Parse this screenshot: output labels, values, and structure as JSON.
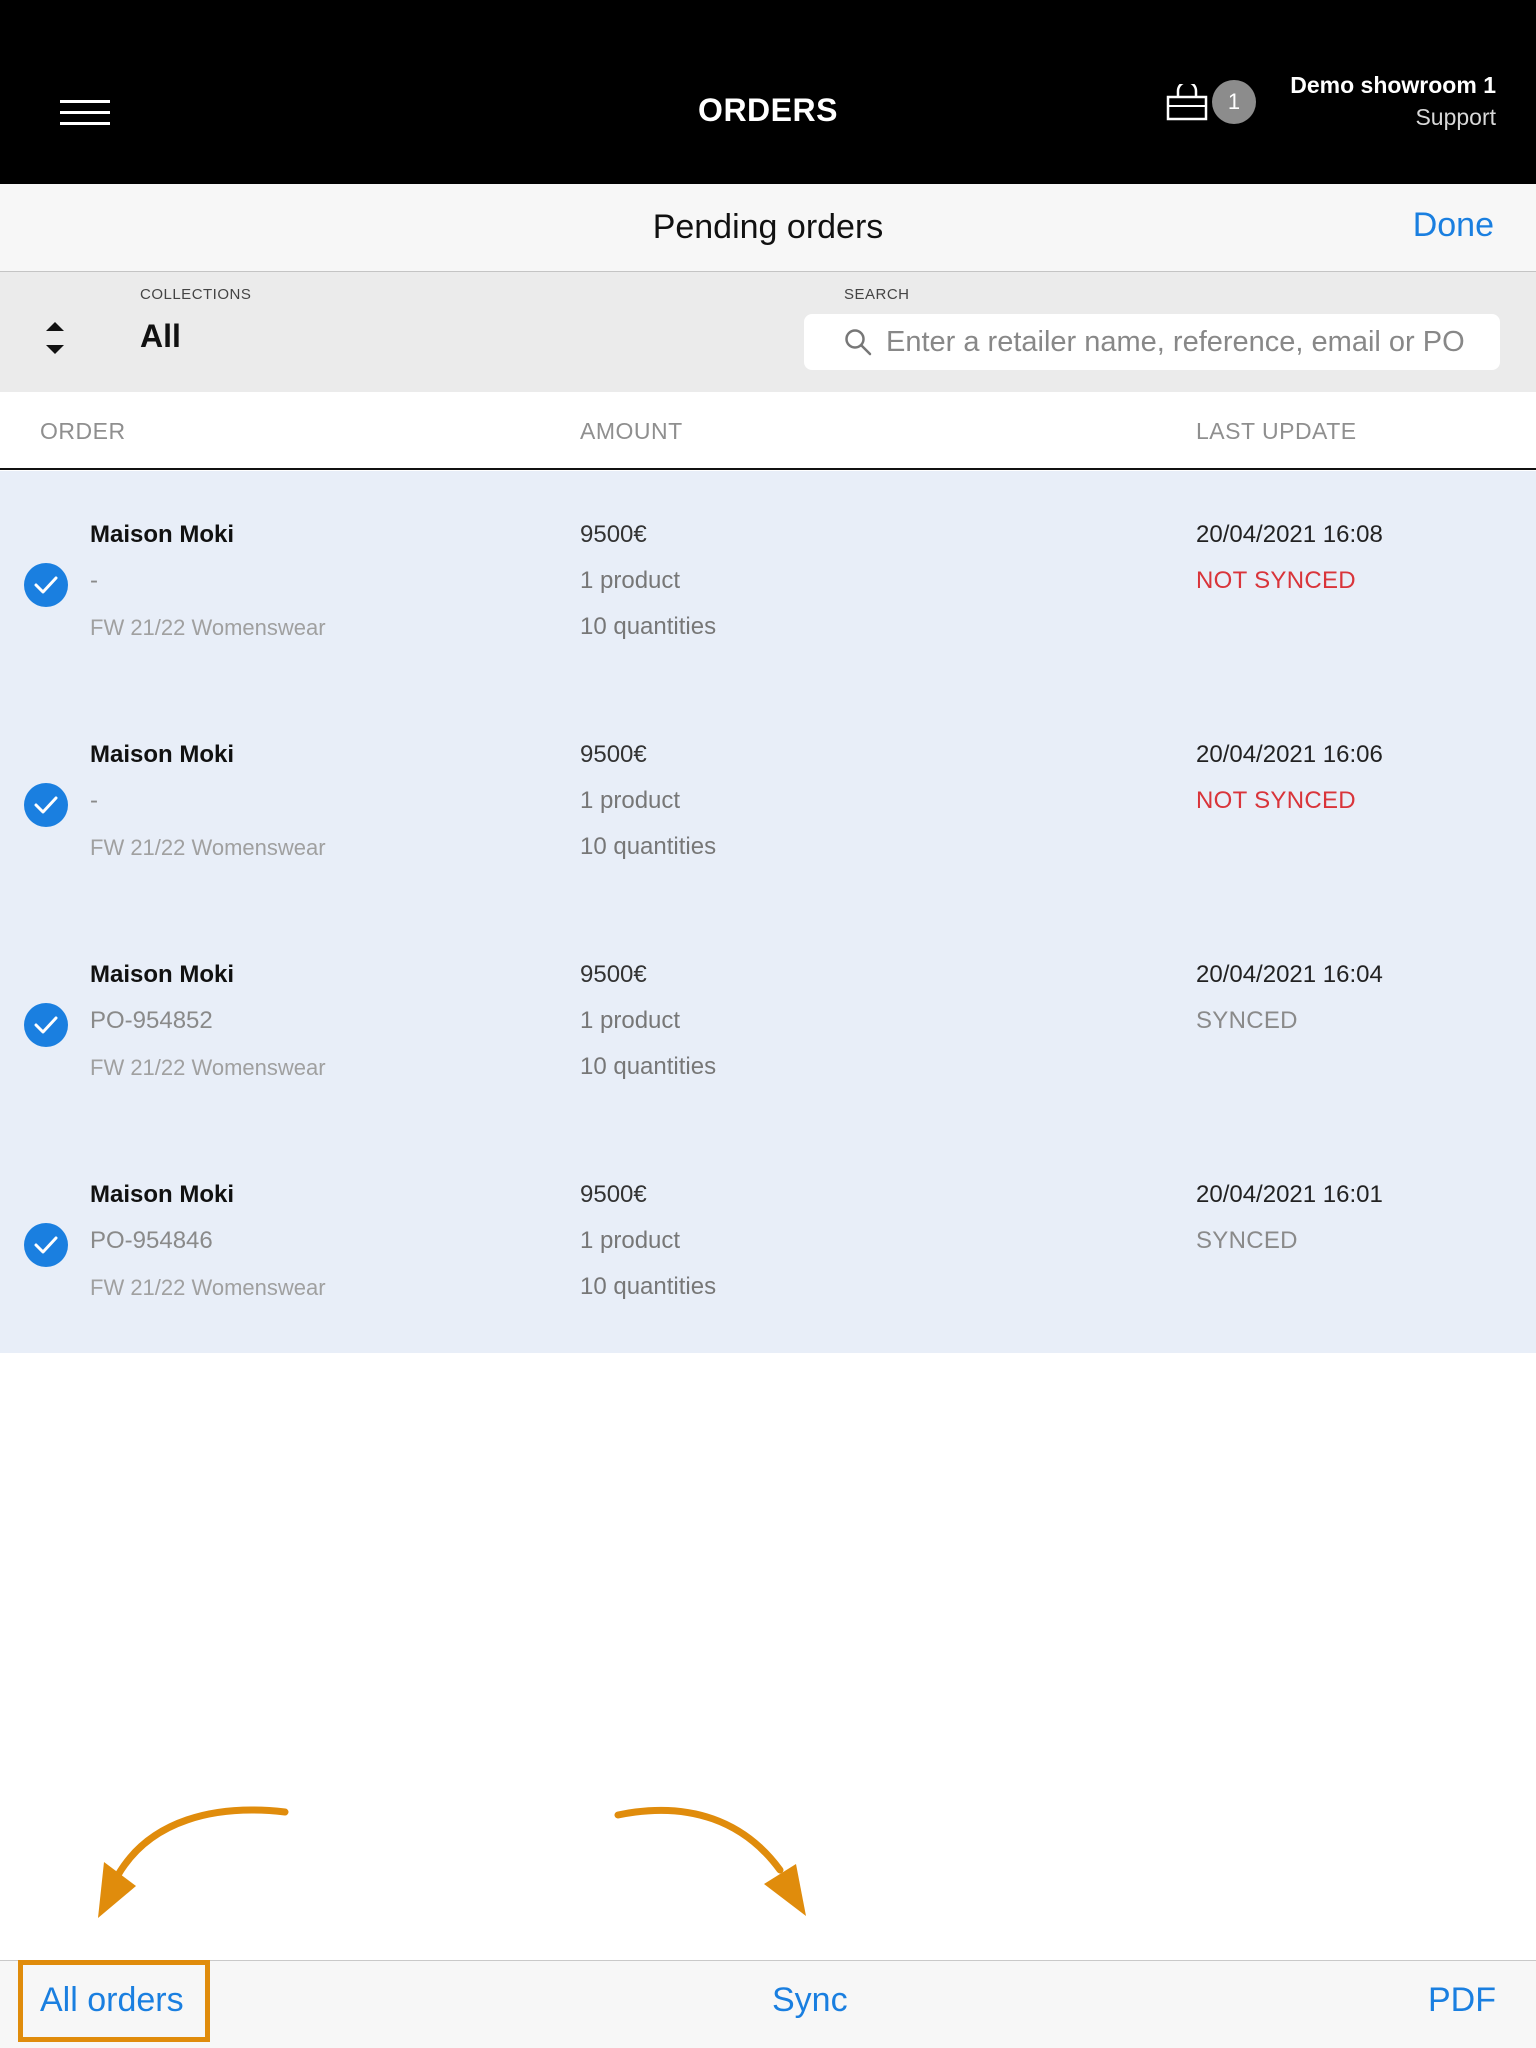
{
  "header": {
    "title": "ORDERS",
    "cart_count": "1",
    "user_name": "Demo showroom 1",
    "user_role": "Support"
  },
  "subbar": {
    "title": "Pending orders",
    "done_label": "Done"
  },
  "filters": {
    "collections_label": "COLLECTIONS",
    "collections_value": "All",
    "search_label": "SEARCH",
    "search_placeholder": "Enter a retailer name, reference, email or PO"
  },
  "columns": {
    "order": "ORDER",
    "amount": "AMOUNT",
    "last_update": "LAST UPDATE"
  },
  "orders": [
    {
      "retailer": "Maison Moki",
      "reference": "-",
      "collection": "FW 21/22 Womenswear",
      "amount": "9500€",
      "products": "1 product",
      "quantities": "10 quantities",
      "date": "20/04/2021 16:08",
      "status": "NOT SYNCED",
      "selected": true
    },
    {
      "retailer": "Maison Moki",
      "reference": "-",
      "collection": "FW 21/22 Womenswear",
      "amount": "9500€",
      "products": "1 product",
      "quantities": "10 quantities",
      "date": "20/04/2021 16:06",
      "status": "NOT SYNCED",
      "selected": true
    },
    {
      "retailer": "Maison Moki",
      "reference": "PO-954852",
      "collection": "FW 21/22 Womenswear",
      "amount": "9500€",
      "products": "1 product",
      "quantities": "10 quantities",
      "date": "20/04/2021 16:04",
      "status": "SYNCED",
      "selected": true
    },
    {
      "retailer": "Maison Moki",
      "reference": "PO-954846",
      "collection": "FW 21/22 Womenswear",
      "amount": "9500€",
      "products": "1 product",
      "quantities": "10 quantities",
      "date": "20/04/2021 16:01",
      "status": "SYNCED",
      "selected": true
    }
  ],
  "toolbar": {
    "all_orders_label": "All orders",
    "sync_label": "Sync",
    "pdf_label": "PDF"
  },
  "colors": {
    "accent": "#1a7fe0",
    "not_synced": "#d9343a",
    "highlight": "#e08c0c",
    "row_background": "#e8eef8"
  },
  "icons": {
    "menu": "hamburger-menu-icon",
    "cart": "shopping-bag-icon",
    "sort": "sort-arrows-icon",
    "search": "search-icon",
    "check": "checkmark-circle-icon"
  }
}
